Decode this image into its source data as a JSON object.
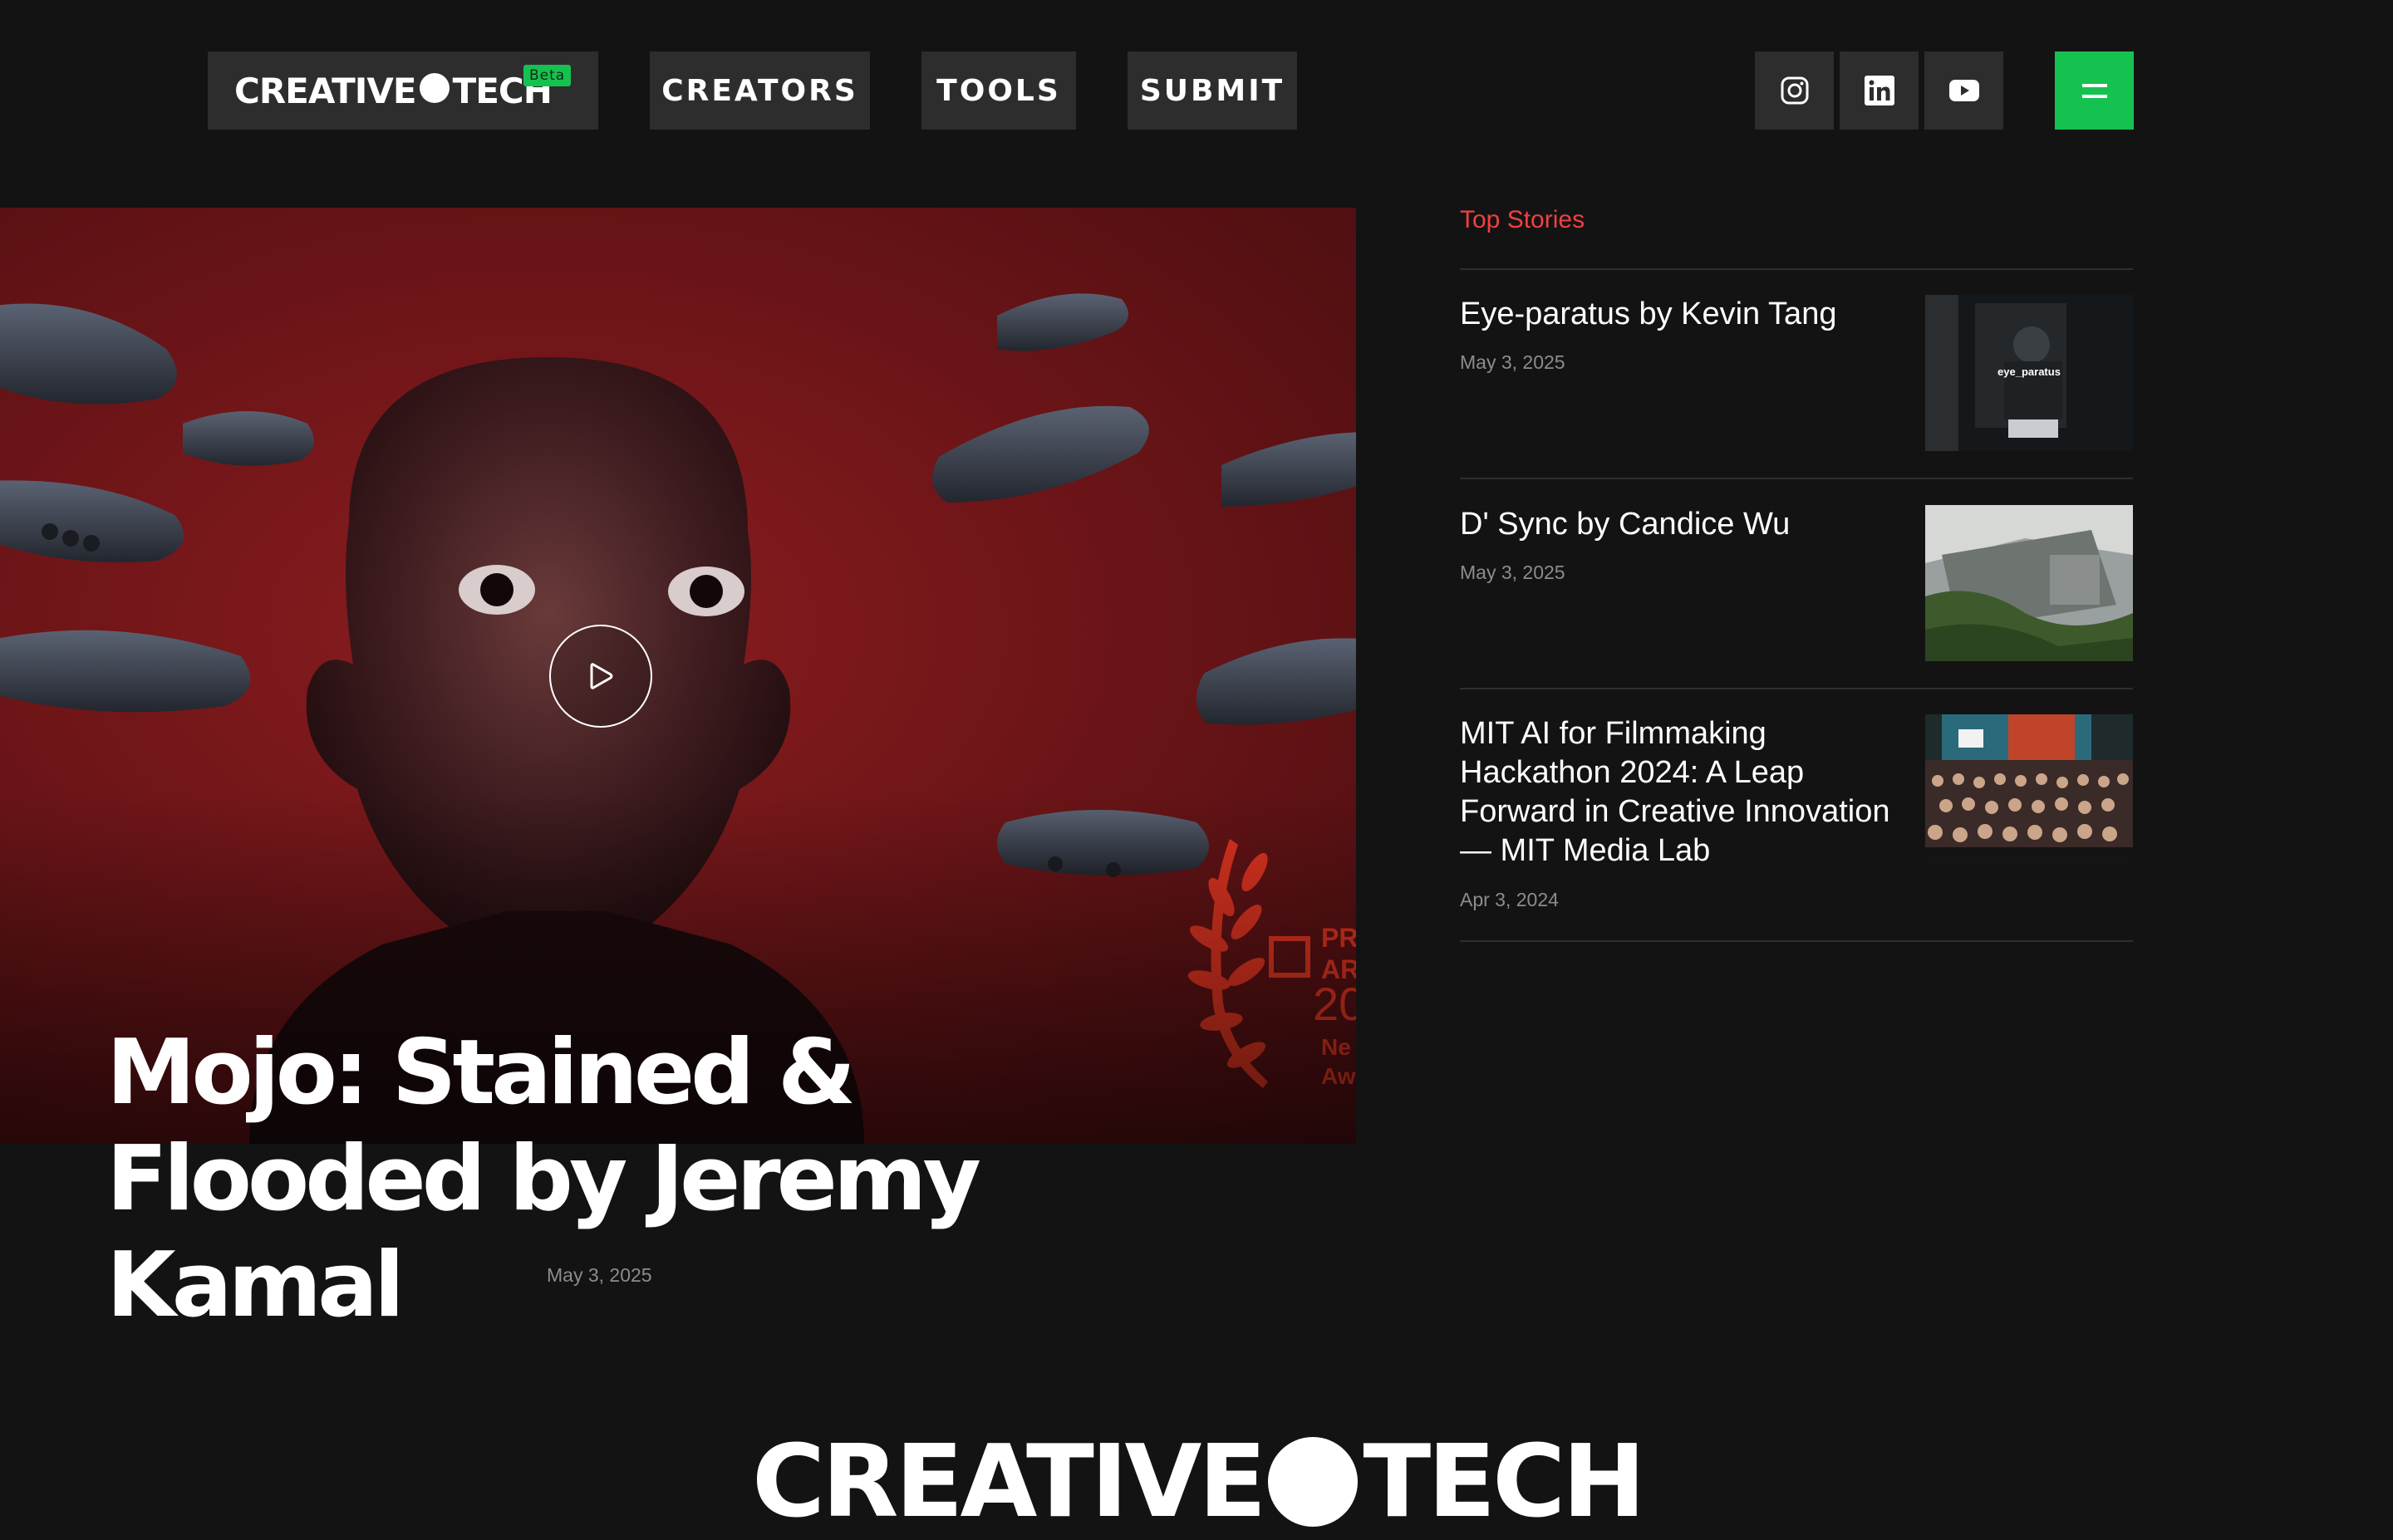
{
  "header": {
    "logo_text_left": "CREATIVE",
    "logo_text_right": "TECH",
    "beta_label": "Beta",
    "nav": [
      {
        "label": "CREATORS"
      },
      {
        "label": "TOOLS"
      },
      {
        "label": "SUBMIT"
      }
    ],
    "social": [
      {
        "icon": "instagram-icon"
      },
      {
        "icon": "linkedin-icon"
      },
      {
        "icon": "youtube-icon"
      }
    ],
    "menu_icon": "hamburger-menu-icon",
    "accent_color": "#16c24f"
  },
  "hero": {
    "title": "Mojo: Stained & Flooded by Jeremy Kamal",
    "date": "May 3, 2025",
    "play_icon": "play-icon",
    "laurel_text": [
      "PR",
      "AR",
      "20",
      "Ne",
      "Aw"
    ]
  },
  "top_stories": {
    "heading": "Top Stories",
    "heading_color": "#f0413f",
    "items": [
      {
        "title": "Eye-paratus by Kevin Tang",
        "date": "May 3, 2025",
        "thumb_caption": "eye_paratus"
      },
      {
        "title": "D' Sync by Candice Wu",
        "date": "May 3, 2025"
      },
      {
        "title": "MIT AI for Filmmaking Hackathon 2024: A Leap Forward in Creative Innovation — MIT Media Lab",
        "date": "Apr 3, 2024"
      }
    ]
  },
  "footer": {
    "logo_text_left": "CREATIVE",
    "logo_text_right": "TECH"
  }
}
